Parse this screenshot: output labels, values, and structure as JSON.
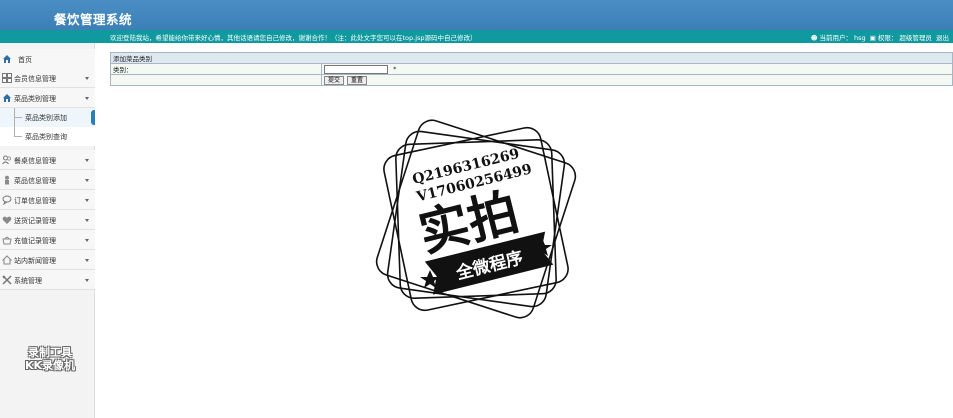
{
  "header": {
    "title": "餐饮管理系统"
  },
  "infobar": {
    "welcome": "欢迎登陆我站，希望能给你带来好心情，其他话语请您自己修改，谢谢合作！（注：此处文字您可以在top.jsp源码中自己修改）",
    "current_user_label": "当前用户：",
    "current_user": "hsg",
    "role_label": "权限：",
    "role": "超级管理员",
    "logout": "退出"
  },
  "sidebar": {
    "home": "首页",
    "items": [
      {
        "label": "会员信息管理",
        "icon": "members-icon"
      },
      {
        "label": "菜品类别管理",
        "icon": "home-icon",
        "expanded": true
      },
      {
        "label": "餐桌信息管理",
        "icon": "people-icon"
      },
      {
        "label": "菜品信息管理",
        "icon": "person-icon"
      },
      {
        "label": "订单信息管理",
        "icon": "chat-icon"
      },
      {
        "label": "送货记录管理",
        "icon": "heart-icon"
      },
      {
        "label": "充值记录管理",
        "icon": "basket-icon"
      },
      {
        "label": "站内新闻管理",
        "icon": "house-icon"
      },
      {
        "label": "系统管理",
        "icon": "tools-icon"
      }
    ],
    "sub_items": [
      {
        "label": "菜品类别添加",
        "active": true
      },
      {
        "label": "菜品类别查询",
        "active": false
      }
    ]
  },
  "form": {
    "caption": "添加菜品类别",
    "field_label": "类别：",
    "field_value": "",
    "required_mark": "*",
    "submit": "提交",
    "reset": "重置"
  },
  "stamp": {
    "line1": "Q2196316269",
    "line2": "V17060256499",
    "big": "实拍",
    "banner": "全微程序"
  },
  "watermark": {
    "line1": "录制工具",
    "line2": "KK录像机"
  },
  "colors": {
    "header": "#3b7fb6",
    "infobar": "#109aa0",
    "sidebar": "#f3f3f3",
    "accent": "#2a7fb9"
  }
}
